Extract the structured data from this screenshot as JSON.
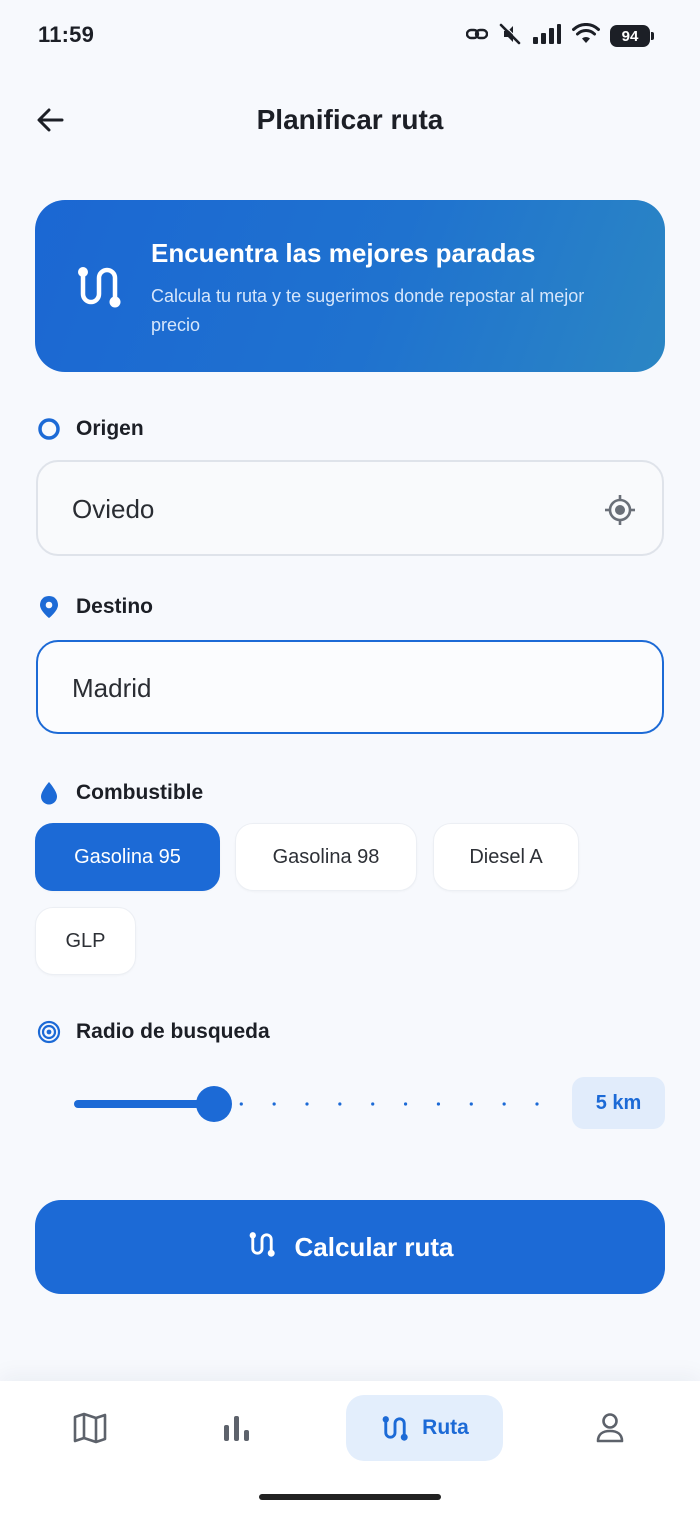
{
  "status_bar": {
    "time": "11:59",
    "battery": "94",
    "icons": [
      "link-icon",
      "mute-icon",
      "signal-icon",
      "wifi-icon",
      "battery-icon"
    ]
  },
  "header": {
    "title": "Planificar ruta",
    "back_icon": "arrow-left-icon"
  },
  "banner": {
    "title": "Encuentra las mejores paradas",
    "subtitle": "Calcula tu ruta y te sugerimos donde repostar al mejor precio",
    "icon": "route-icon"
  },
  "origin": {
    "label": "Origen",
    "value": "Oviedo",
    "icon": "circle-icon",
    "action_icon": "gps-target-icon"
  },
  "destination": {
    "label": "Destino",
    "value": "Madrid",
    "icon": "location-pin-icon"
  },
  "fuel": {
    "label": "Combustible",
    "icon": "drop-icon",
    "options": [
      "Gasolina 95",
      "Gasolina 98",
      "Diesel A",
      "GLP"
    ],
    "selected": "Gasolina 95"
  },
  "radius": {
    "label": "Radio de busqueda",
    "icon": "radar-icon",
    "value_label": "5 km",
    "slider_fraction": 0.28
  },
  "calculate_button": {
    "label": "Calcular ruta",
    "icon": "route-icon"
  },
  "bottom_nav": {
    "items": [
      {
        "icon": "map-icon",
        "label": ""
      },
      {
        "icon": "bar-chart-icon",
        "label": ""
      },
      {
        "icon": "route-icon",
        "label": "Ruta"
      },
      {
        "icon": "user-icon",
        "label": ""
      }
    ],
    "active": "Ruta"
  },
  "colors": {
    "primary": "#1c6ad6",
    "background": "#f7f9fd",
    "chip_active_bg": "#1c6ad6",
    "badge_bg": "#e1ecfb"
  }
}
